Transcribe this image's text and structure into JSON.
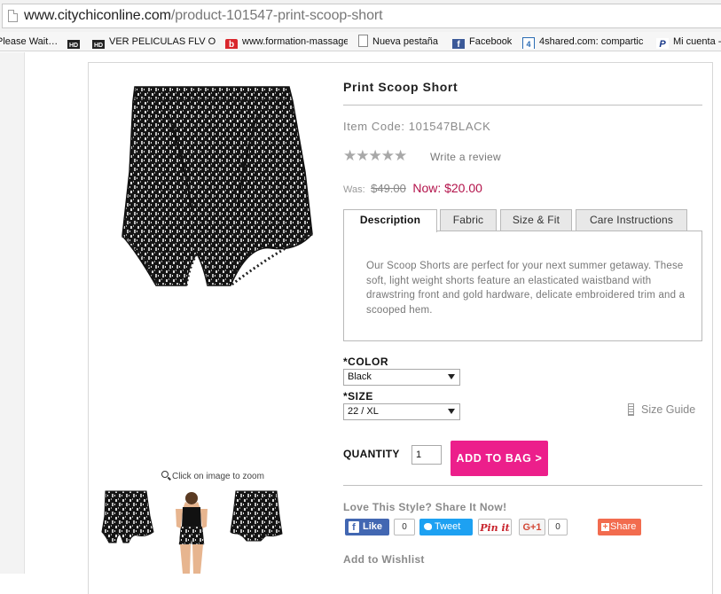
{
  "browser": {
    "url_domain": "www.citychiconline.com",
    "url_path": "/product-101547-print-scoop-short",
    "bookmarks": [
      {
        "label": "Please Wait…",
        "icon": "none"
      },
      {
        "label": "HD",
        "icon": "hd-icon"
      },
      {
        "label": "VER PELICULAS FLV ONL",
        "icon": "hd-icon"
      },
      {
        "label": "www.formation-massage",
        "icon": "red-b-icon"
      },
      {
        "label": "Nueva pestaña",
        "icon": "page-icon"
      },
      {
        "label": "Facebook",
        "icon": "facebook-icon"
      },
      {
        "label": "4shared.com: compartic",
        "icon": "4shared-icon"
      },
      {
        "label": "Mi cuenta -",
        "icon": "paypal-icon"
      }
    ]
  },
  "product": {
    "title": "Print Scoop Short",
    "item_code": "Item Code: 101547BLACK",
    "rating": {
      "stars": "★★★★★",
      "value": 0,
      "max": 5
    },
    "review_link": "Write a review",
    "price": {
      "was_label": "Was:",
      "was": "$49.00",
      "now": "Now: $20.00"
    },
    "zoom_hint": "Click on image to zoom",
    "thumbnails": [
      "shorts-front",
      "model-wearing",
      "shorts-side"
    ]
  },
  "tabs": [
    {
      "label": "Description",
      "active": true
    },
    {
      "label": "Fabric",
      "active": false
    },
    {
      "label": "Size & Fit",
      "active": false
    },
    {
      "label": "Care Instructions",
      "active": false
    }
  ],
  "description": "Our Scoop Shorts are perfect for your next summer getaway. These soft, light weight shorts feature an elasticated waistband with drawstring front and gold hardware, delicate embroidered trim and a scooped hem.",
  "options": {
    "color_label": "*COLOR",
    "color_value": "Black",
    "size_label": "*SIZE",
    "size_value": "22 / XL",
    "size_guide": "Size Guide"
  },
  "purchase": {
    "quantity_label": "QUANTITY",
    "quantity_value": "1",
    "add_to_bag": "ADD TO BAG >"
  },
  "share": {
    "title": "Love This Style? Share It Now!",
    "facebook_label": "Like",
    "facebook_count": "0",
    "twitter_label": "Tweet",
    "pinterest_label": "Pin it",
    "gplus_label": "G+1",
    "gplus_count": "0",
    "share_label": "Share"
  },
  "wishlist": "Add to Wishlist",
  "colors": {
    "accent_pink": "#ec1f8b",
    "price_now": "#b3124a",
    "facebook": "#4267b2",
    "twitter": "#1da1f2",
    "share": "#f26c4f"
  }
}
